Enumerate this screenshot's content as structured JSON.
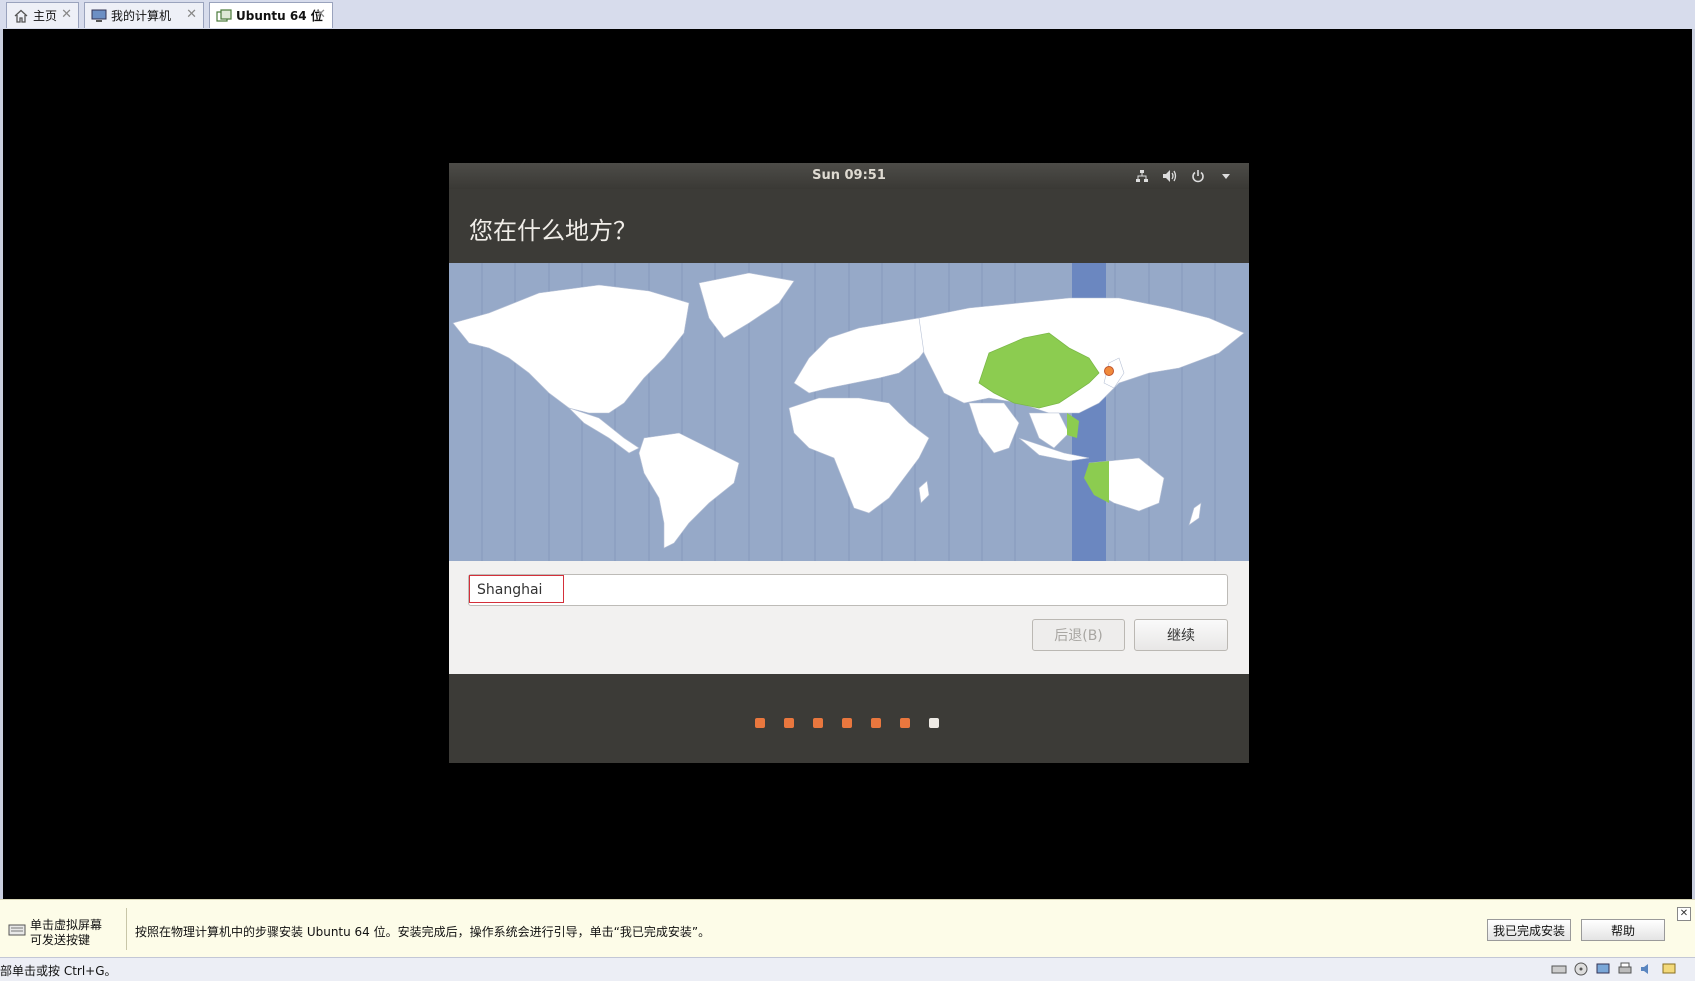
{
  "tabs": [
    {
      "label": "主页",
      "icon": "home-icon"
    },
    {
      "label": "我的计算机",
      "icon": "computer-icon"
    },
    {
      "label": "Ubuntu 64 位",
      "icon": "vm-icon",
      "active": true
    }
  ],
  "guest": {
    "clock": "Sun 09:51",
    "tray_icons": [
      "network-icon",
      "volume-icon",
      "power-icon",
      "dropdown-arrow-icon"
    ],
    "title": "您在什么地方？",
    "location_value": "Shanghai",
    "back_label": "后退(B)",
    "continue_label": "继续",
    "progress": {
      "total": 7,
      "current": 7
    },
    "colors": {
      "accent": "#e9773e",
      "highlight_region": "#8ccc50",
      "selected_zone": "#6b87c0",
      "map_water": "#96a9c8"
    }
  },
  "notification": {
    "left_text_line1": "单击虚拟屏幕",
    "left_text_line2": "可发送按键",
    "message": "按照在物理计算机中的步骤安装 Ubuntu 64 位。安装完成后，操作系统会进行引导，单击“我已完成安装”。",
    "done_button": "我已完成安装",
    "help_button": "帮助"
  },
  "statusbar": {
    "text": "部单击或按 Ctrl+G。",
    "icons": [
      "hdd-icon",
      "cd-icon",
      "network-adapter-icon",
      "printer-icon",
      "sound-icon",
      "message-icon"
    ]
  }
}
